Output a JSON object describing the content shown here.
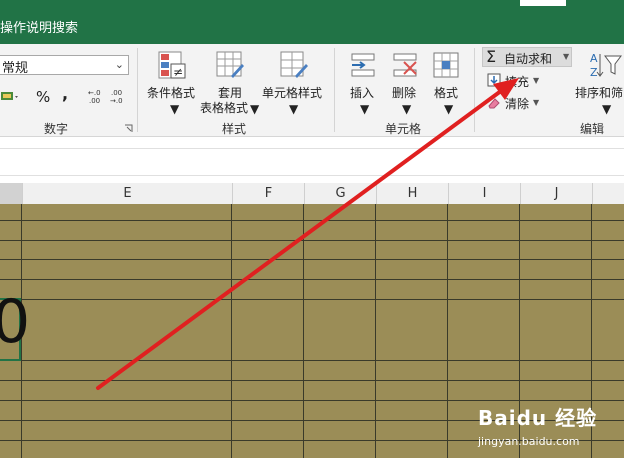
{
  "titlebar": {
    "tell_me": "操作说明搜索"
  },
  "ribbon": {
    "number": {
      "format_value": "常规",
      "percent": "%",
      "comma": ",",
      "inc_decimal": "←.0\n.00",
      "dec_decimal": ".00\n→.0",
      "group_label": "数字"
    },
    "styles": {
      "conditional_format": "条件格式",
      "format_table_line1": "套用",
      "format_table_line2": "表格格式",
      "cell_styles": "单元格样式",
      "group_label": "样式"
    },
    "cells": {
      "insert": "插入",
      "delete": "删除",
      "format": "格式",
      "group_label": "单元格"
    },
    "editing": {
      "autosum": "自动求和",
      "fill": "填充",
      "clear": "清除",
      "sort_filter": "排序和筛",
      "group_label": "编辑"
    }
  },
  "grid": {
    "columns": [
      "E",
      "F",
      "G",
      "H",
      "I",
      "J"
    ],
    "visible_cell_value": "0",
    "cell_fill_color": "#9b8d57"
  },
  "annotation": {
    "arrow_color": "#e02020"
  },
  "watermark": {
    "logo": "Baidu 经验",
    "url": "jingyan.baidu.com"
  },
  "colors": {
    "excel_green": "#217346"
  }
}
